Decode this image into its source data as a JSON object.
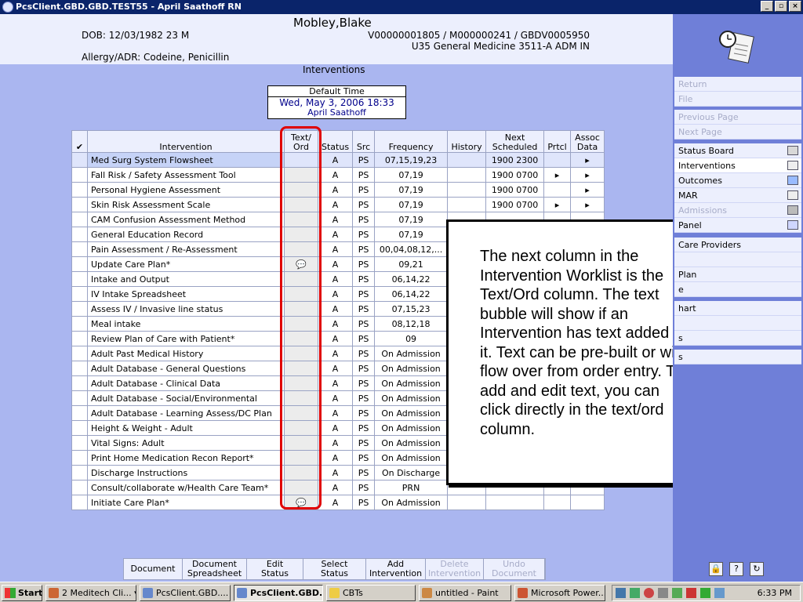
{
  "window": {
    "title": "PcsClient.GBD.GBD.TEST55 - April Saathoff RN",
    "min": "_",
    "max": "▫",
    "close": "×"
  },
  "patient": {
    "name": "Mobley,Blake",
    "dob": "DOB: 12/03/1982 23 M",
    "account": "V00000001805 / M000000241 / GBDV0005950",
    "unit": "U35 General Medicine  3511-A  ADM IN",
    "allergy": "Allergy/ADR: Codeine, Penicillin"
  },
  "section_title": "Interventions",
  "default_time": {
    "label": "Default Time",
    "date": "Wed, May 3, 2006  18:33",
    "user": "April Saathoff"
  },
  "columns": {
    "check": "✔",
    "intervention": "Intervention",
    "textord": "Text/ Ord",
    "status": "Status",
    "src": "Src",
    "frequency": "Frequency",
    "history": "History",
    "next": "Next Scheduled",
    "prtcl": "Prtcl",
    "assoc": "Assoc Data"
  },
  "rows": [
    {
      "name": "Med Surg System Flowsheet",
      "text": "",
      "status": "A",
      "src": "PS",
      "freq": "07,15,19,23",
      "history": "",
      "next": "1900 2300",
      "prtcl": "",
      "assoc": "▸"
    },
    {
      "name": "Fall Risk / Safety Assessment Tool",
      "text": "",
      "status": "A",
      "src": "PS",
      "freq": "07,19",
      "history": "",
      "next": "1900 0700",
      "prtcl": "▸",
      "assoc": "▸"
    },
    {
      "name": "Personal Hygiene Assessment",
      "text": "",
      "status": "A",
      "src": "PS",
      "freq": "07,19",
      "history": "",
      "next": "1900 0700",
      "prtcl": "",
      "assoc": "▸"
    },
    {
      "name": "Skin Risk Assessment Scale",
      "text": "",
      "status": "A",
      "src": "PS",
      "freq": "07,19",
      "history": "",
      "next": "1900 0700",
      "prtcl": "▸",
      "assoc": "▸"
    },
    {
      "name": "CAM Confusion Assessment Method",
      "text": "",
      "status": "A",
      "src": "PS",
      "freq": "07,19",
      "history": "",
      "next": "",
      "prtcl": "",
      "assoc": ""
    },
    {
      "name": "General Education Record",
      "text": "",
      "status": "A",
      "src": "PS",
      "freq": "07,19",
      "history": "",
      "next": "",
      "prtcl": "",
      "assoc": ""
    },
    {
      "name": "Pain Assessment / Re-Assessment",
      "text": "",
      "status": "A",
      "src": "PS",
      "freq": "00,04,08,12,...",
      "history": "",
      "next": "",
      "prtcl": "",
      "assoc": ""
    },
    {
      "name": "Update Care Plan*",
      "text": "💬",
      "status": "A",
      "src": "PS",
      "freq": "09,21",
      "history": "",
      "next": "",
      "prtcl": "",
      "assoc": ""
    },
    {
      "name": "Intake and Output",
      "text": "",
      "status": "A",
      "src": "PS",
      "freq": "06,14,22",
      "history": "",
      "next": "",
      "prtcl": "",
      "assoc": ""
    },
    {
      "name": "IV Intake Spreadsheet",
      "text": "",
      "status": "A",
      "src": "PS",
      "freq": "06,14,22",
      "history": "",
      "next": "",
      "prtcl": "",
      "assoc": ""
    },
    {
      "name": "Assess IV / Invasive line status",
      "text": "",
      "status": "A",
      "src": "PS",
      "freq": "07,15,23",
      "history": "",
      "next": "",
      "prtcl": "",
      "assoc": ""
    },
    {
      "name": "Meal intake",
      "text": "",
      "status": "A",
      "src": "PS",
      "freq": "08,12,18",
      "history": "",
      "next": "",
      "prtcl": "",
      "assoc": ""
    },
    {
      "name": "Review Plan of Care with Patient*",
      "text": "",
      "status": "A",
      "src": "PS",
      "freq": "09",
      "history": "",
      "next": "",
      "prtcl": "",
      "assoc": ""
    },
    {
      "name": "Adult Past Medical History",
      "text": "",
      "status": "A",
      "src": "PS",
      "freq": "On Admission",
      "history": "",
      "next": "",
      "prtcl": "",
      "assoc": ""
    },
    {
      "name": "Adult Database - General Questions",
      "text": "",
      "status": "A",
      "src": "PS",
      "freq": "On Admission",
      "history": "",
      "next": "",
      "prtcl": "",
      "assoc": ""
    },
    {
      "name": "Adult Database - Clinical Data",
      "text": "",
      "status": "A",
      "src": "PS",
      "freq": "On Admission",
      "history": "",
      "next": "",
      "prtcl": "",
      "assoc": ""
    },
    {
      "name": "Adult Database - Social/Environmental",
      "text": "",
      "status": "A",
      "src": "PS",
      "freq": "On Admission",
      "history": "",
      "next": "",
      "prtcl": "",
      "assoc": ""
    },
    {
      "name": "Adult Database - Learning Assess/DC Plan",
      "text": "",
      "status": "A",
      "src": "PS",
      "freq": "On Admission",
      "history": "",
      "next": "",
      "prtcl": "",
      "assoc": ""
    },
    {
      "name": "Height & Weight - Adult",
      "text": "",
      "status": "A",
      "src": "PS",
      "freq": "On Admission",
      "history": "",
      "next": "",
      "prtcl": "",
      "assoc": ""
    },
    {
      "name": "Vital Signs: Adult",
      "text": "",
      "status": "A",
      "src": "PS",
      "freq": "On Admission",
      "history": "",
      "next": "",
      "prtcl": "",
      "assoc": ""
    },
    {
      "name": "Print Home Medication Recon Report*",
      "text": "",
      "status": "A",
      "src": "PS",
      "freq": "On Admission",
      "history": "",
      "next": "",
      "prtcl": "",
      "assoc": ""
    },
    {
      "name": "Discharge Instructions",
      "text": "",
      "status": "A",
      "src": "PS",
      "freq": "On Discharge",
      "history": "",
      "next": "",
      "prtcl": "",
      "assoc": ""
    },
    {
      "name": "Consult/collaborate w/Health Care Team*",
      "text": "",
      "status": "A",
      "src": "PS",
      "freq": "PRN",
      "history": "",
      "next": "",
      "prtcl": "",
      "assoc": ""
    },
    {
      "name": "Initiate Care Plan*",
      "text": "💬",
      "status": "A",
      "src": "PS",
      "freq": "On Admission",
      "history": "",
      "next": "",
      "prtcl": "",
      "assoc": ""
    }
  ],
  "callout": "The next column in the Intervention Worklist is the Text/Ord column. The text bubble will show if an Intervention has text added to it. Text can be pre-built or will flow over from order entry. To add and edit text, you can click directly in the text/ord column.",
  "toolbar": [
    {
      "label": "Document",
      "enabled": true
    },
    {
      "label": "Document Spreadsheet",
      "enabled": true
    },
    {
      "label": "Edit Status",
      "enabled": true
    },
    {
      "label": "Select Status",
      "enabled": true
    },
    {
      "label": "Add Intervention",
      "enabled": true
    },
    {
      "label": "Delete Intervention",
      "enabled": false
    },
    {
      "label": "Undo Document",
      "enabled": false
    }
  ],
  "nav_groups": [
    [
      {
        "label": "Return",
        "disabled": true
      },
      {
        "label": "File",
        "disabled": true
      }
    ],
    [
      {
        "label": "Previous Page",
        "disabled": true
      },
      {
        "label": "Next Page",
        "disabled": true
      }
    ],
    [
      {
        "label": "Status Board",
        "icon": "book-icon"
      },
      {
        "label": "Interventions",
        "icon": "clock-icon",
        "active": true
      },
      {
        "label": "Outcomes",
        "icon": "check-icon"
      },
      {
        "label": "MAR",
        "icon": "clock-icon"
      },
      {
        "label": "Admissions",
        "icon": "tag-icon",
        "disabled": true
      },
      {
        "label": "Panel",
        "icon": "pulse-icon"
      }
    ],
    [
      {
        "label": "Care Providers"
      },
      {
        "label": ""
      },
      {
        "label": "Plan"
      },
      {
        "label": "e"
      }
    ],
    [
      {
        "label": "hart"
      },
      {
        "label": ""
      },
      {
        "label": "s"
      }
    ],
    [
      {
        "label": "s"
      }
    ]
  ],
  "panel_buttons": [
    "lock-icon",
    "help-icon",
    "refresh-icon"
  ],
  "taskbar": {
    "start": "Start",
    "tasks": [
      {
        "label": "2 Meditech Cli... ▾",
        "active": false,
        "color": "#c63"
      },
      {
        "label": "PcsClient.GBD....",
        "active": false,
        "color": "#68c"
      },
      {
        "label": "PcsClient.GBD...",
        "active": true,
        "color": "#68c"
      },
      {
        "label": "CBTs",
        "active": false,
        "color": "#ec4"
      },
      {
        "label": "untitled - Paint",
        "active": false,
        "color": "#c84"
      },
      {
        "label": "Microsoft Power...",
        "active": false,
        "color": "#c53"
      }
    ],
    "clock": "6:33 PM"
  },
  "colors": {
    "highlight": "#e00000",
    "titlebar": "#0a246a",
    "main_bg": "#aab6f0",
    "panel_bg": "#6f7fd8"
  }
}
